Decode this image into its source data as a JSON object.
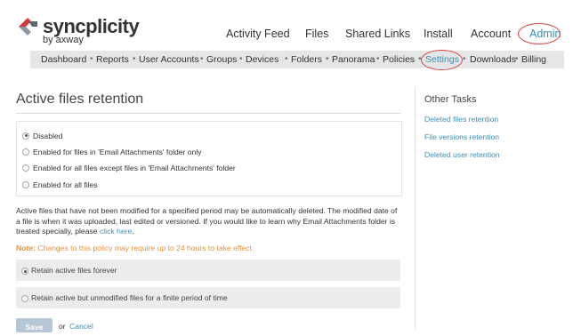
{
  "brand": {
    "name": "syncplicity",
    "subtitle": "by axway"
  },
  "top_nav": [
    "Activity Feed",
    "Files",
    "Shared Links",
    "Install",
    "Account",
    "Admin"
  ],
  "sub_nav": [
    "Dashboard",
    "Reports",
    "User Accounts",
    "Groups",
    "Devices",
    "Folders",
    "Panorama",
    "Policies",
    "Settings",
    "Downloads",
    "Billing"
  ],
  "active_sub_nav": "Settings",
  "page_title": "Active files retention",
  "retention_options": [
    {
      "label": "Disabled",
      "checked": true
    },
    {
      "label": "Enabled for files in 'Email Attachments' folder only",
      "checked": false
    },
    {
      "label": "Enabled for all files except files in 'Email Attachments' folder",
      "checked": false
    },
    {
      "label": "Enabled for all files",
      "checked": false
    }
  ],
  "description": "Active files that have not been modified for a specified period may be automatically deleted. The modified date of a file is when it was uploaded, last edited or versioned. If you would like to learn why Email Attachments folder is treated specially, please",
  "description_link": "click here",
  "description_end": ".",
  "note_label": "Note:",
  "note_text": "Changes to this policy may require up to 24 hours to take effect.",
  "period_options": [
    {
      "label": "Retain active files forever",
      "checked": true
    },
    {
      "label": "Retain active but unmodified files for a finite period of time",
      "checked": false
    }
  ],
  "save_label": "Save",
  "or_text": "or",
  "cancel_label": "Cancel",
  "sidebar": {
    "title": "Other Tasks",
    "links": [
      "Deleted files retention",
      "File versions retention",
      "Deleted user retention"
    ]
  },
  "colors": {
    "link": "#3a8fb7",
    "note": "#e8913a",
    "highlight": "#d64545",
    "subnav_bg": "#e5e6e6"
  }
}
